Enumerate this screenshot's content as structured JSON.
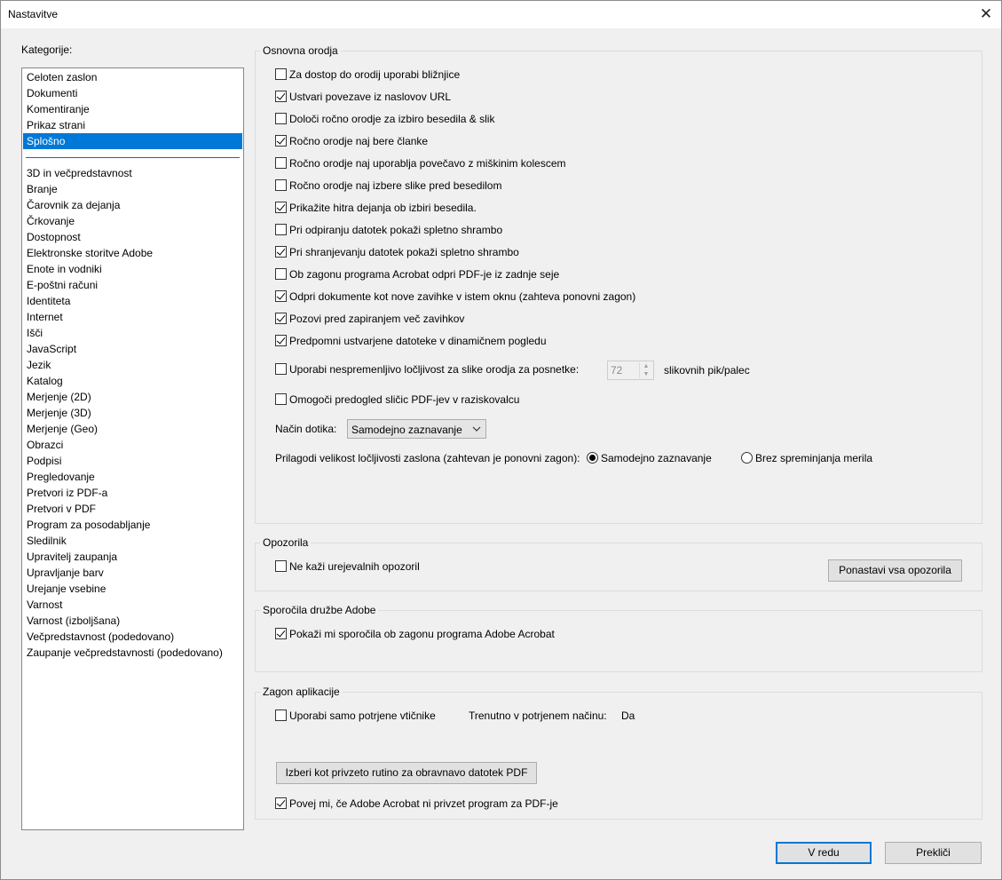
{
  "window": {
    "title": "Nastavitve",
    "close": "✕"
  },
  "categories": {
    "heading": "Kategorije:",
    "top_items": [
      "Celoten zaslon",
      "Dokumenti",
      "Komentiranje",
      "Prikaz strani",
      "Splošno"
    ],
    "selected": "Splošno",
    "items": [
      "3D in večpredstavnost",
      "Branje",
      "Čarovnik za dejanja",
      "Črkovanje",
      "Dostopnost",
      "Elektronske storitve Adobe",
      "Enote in vodniki",
      "E-poštni računi",
      "Identiteta",
      "Internet",
      "Išči",
      "JavaScript",
      "Jezik",
      "Katalog",
      "Merjenje (2D)",
      "Merjenje (3D)",
      "Merjenje (Geo)",
      "Obrazci",
      "Podpisi",
      "Pregledovanje",
      "Pretvori iz PDF-a",
      "Pretvori v PDF",
      "Program za posodabljanje",
      "Sledilnik",
      "Upravitelj zaupanja",
      "Upravljanje barv",
      "Urejanje vsebine",
      "Varnost",
      "Varnost (izboljšana)",
      "Večpredstavnost (podedovano)",
      "Zaupanje večpredstavnosti (podedovano)"
    ]
  },
  "basic_tools": {
    "label": "Osnovna orodja",
    "options": [
      {
        "label": "Za dostop do orodij uporabi bližnjice",
        "checked": false
      },
      {
        "label": "Ustvari povezave iz naslovov URL",
        "checked": true
      },
      {
        "label": "Določi ročno orodje za izbiro besedila & slik",
        "checked": false
      },
      {
        "label": "Ročno orodje naj bere članke",
        "checked": true
      },
      {
        "label": "Ročno orodje naj uporablja povečavo z miškinim kolescem",
        "checked": false
      },
      {
        "label": "Ročno orodje naj izbere slike pred besedilom",
        "checked": false
      },
      {
        "label": "Prikažite hitra dejanja ob izbiri besedila.",
        "checked": true
      },
      {
        "label": "Pri odpiranju datotek pokaži spletno shrambo",
        "checked": false
      },
      {
        "label": "Pri shranjevanju datotek pokaži spletno shrambo",
        "checked": true
      },
      {
        "label": "Ob zagonu programa Acrobat odpri PDF-je iz zadnje seje",
        "checked": false
      },
      {
        "label": "Odpri dokumente kot nove zavihke v istem oknu (zahteva ponovni zagon)",
        "checked": true
      },
      {
        "label": "Pozovi pred zapiranjem več zavihkov",
        "checked": true
      },
      {
        "label": "Predpomni ustvarjene datoteke v dinamičnem pogledu",
        "checked": true
      }
    ],
    "fixed_resolution": {
      "label": "Uporabi nespremenljivo ločljivost za slike orodja za posnetke:",
      "checked": false,
      "value": "72",
      "unit": "slikovnih pik/palec"
    },
    "thumbnail_preview": {
      "label": "Omogoči predogled sličic PDF-jev v raziskovalcu",
      "checked": false
    },
    "touch_mode": {
      "label": "Način dotika:",
      "value": "Samodejno zaznavanje"
    },
    "scaling": {
      "label": "Prilagodi velikost ločljivosti zaslona (zahtevan je ponovni zagon):",
      "options": [
        {
          "label": "Samodejno zaznavanje",
          "selected": true
        },
        {
          "label": "Brez spreminjanja merila",
          "selected": false
        }
      ]
    }
  },
  "warnings": {
    "label": "Opozorila",
    "no_edit_warnings": {
      "label": "Ne kaži urejevalnih opozoril",
      "checked": false
    },
    "reset_button": "Ponastavi vsa opozorila"
  },
  "adobe_messages": {
    "label": "Sporočila družbe Adobe",
    "show_messages": {
      "label": "Pokaži mi sporočila ob zagonu programa Adobe Acrobat",
      "checked": true
    }
  },
  "app_startup": {
    "label": "Zagon aplikacije",
    "certified_plugins": {
      "label": "Uporabi samo potrjene vtičnike",
      "checked": false
    },
    "current_mode_label": "Trenutno v potrjenem načinu:",
    "current_mode_value": "Da",
    "default_handler_button": "Izberi kot privzeto rutino za obravnavo datotek PDF",
    "tell_me": {
      "label": "Povej mi, če Adobe Acrobat ni privzet program za PDF-je",
      "checked": true
    }
  },
  "footer": {
    "ok": "V redu",
    "cancel": "Prekliči"
  }
}
